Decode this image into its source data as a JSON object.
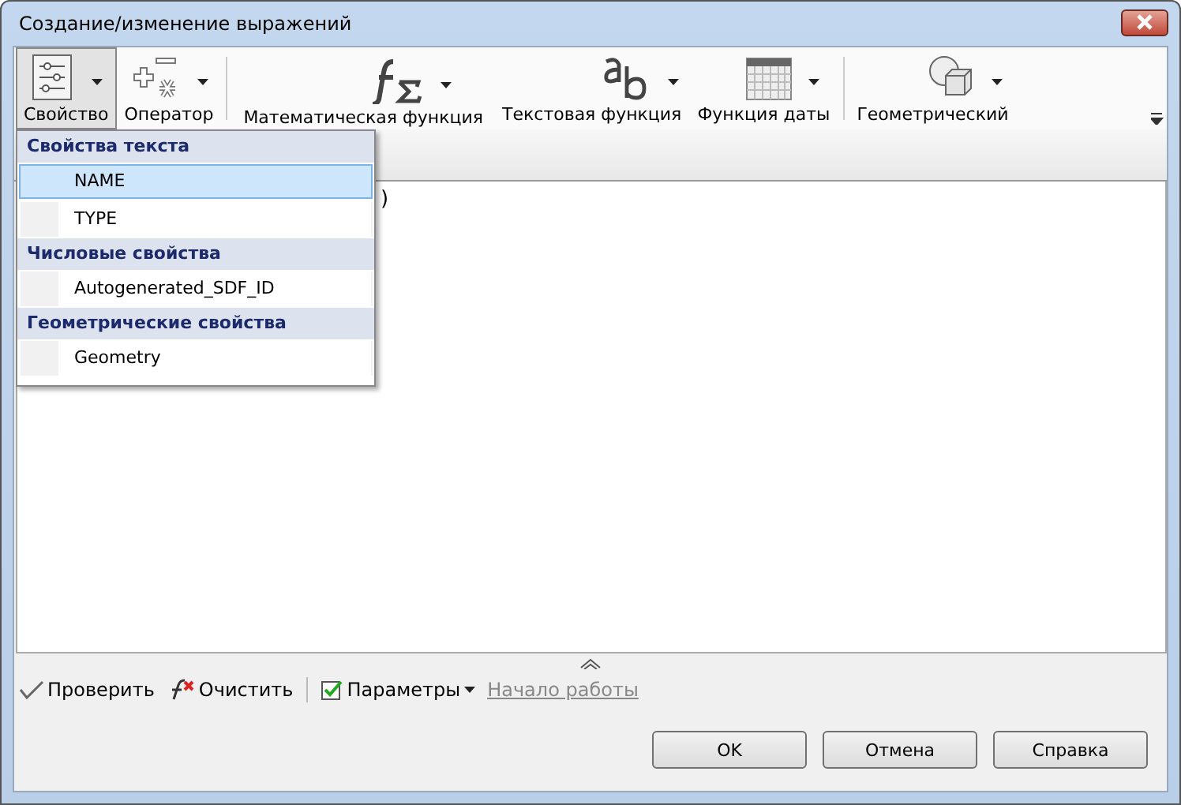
{
  "window": {
    "title": "Создание/изменение выражений"
  },
  "toolbar": [
    {
      "kind": "property",
      "label": "Свойство",
      "selected": true
    },
    {
      "kind": "operator",
      "label": "Оператор",
      "selected": false
    },
    {
      "kind": "math",
      "label": "Математическая функция",
      "selected": false
    },
    {
      "kind": "text",
      "label": "Текстовая функция",
      "selected": false
    },
    {
      "kind": "date",
      "label": "Функция даты",
      "selected": false
    },
    {
      "kind": "geometry",
      "label": "Геометрический",
      "selected": false
    }
  ],
  "editor": {
    "text": ")"
  },
  "dropdown": [
    {
      "kind": "header",
      "label": "Свойства текста"
    },
    {
      "kind": "item",
      "label": "NAME",
      "selected": true
    },
    {
      "kind": "item",
      "label": "TYPE",
      "selected": false
    },
    {
      "kind": "header",
      "label": "Числовые свойства"
    },
    {
      "kind": "item",
      "label": "Autogenerated_SDF_ID",
      "selected": false
    },
    {
      "kind": "header",
      "label": "Геометрические свойства"
    },
    {
      "kind": "item",
      "label": "Geometry",
      "selected": false
    }
  ],
  "bottom_toolbar": {
    "verify": "Проверить",
    "clear": "Очистить",
    "parameters": "Параметры",
    "link": "Начало работы"
  },
  "buttons": [
    "OK",
    "Отмена",
    "Справка"
  ]
}
